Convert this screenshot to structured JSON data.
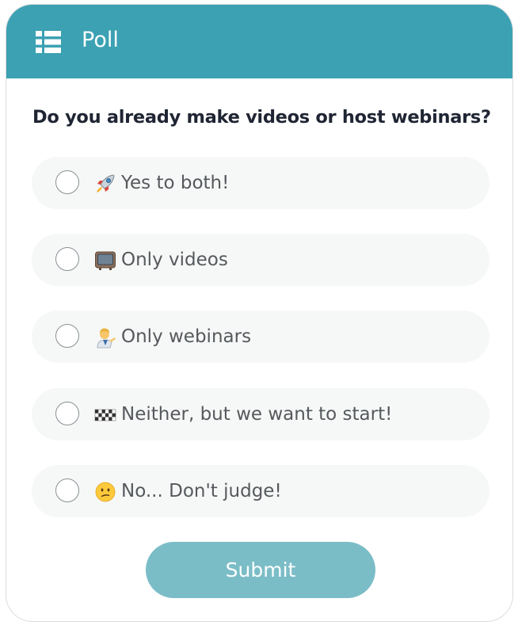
{
  "header": {
    "title": "Poll",
    "icon": "list-icon",
    "background_color": "#3ba1b3"
  },
  "question": "Do you already make videos or host webinars?",
  "options": [
    {
      "label": "Yes to both!",
      "icon": "rocket-icon"
    },
    {
      "label": "Only videos",
      "icon": "television-icon"
    },
    {
      "label": "Only webinars",
      "icon": "person-presenting-icon"
    },
    {
      "label": "Neither, but we want to start!",
      "icon": "checkered-flag-icon"
    },
    {
      "label": "No... Don't judge!",
      "icon": "confused-face-icon"
    }
  ],
  "submit": {
    "label": "Submit",
    "color": "#7bbdc7"
  }
}
